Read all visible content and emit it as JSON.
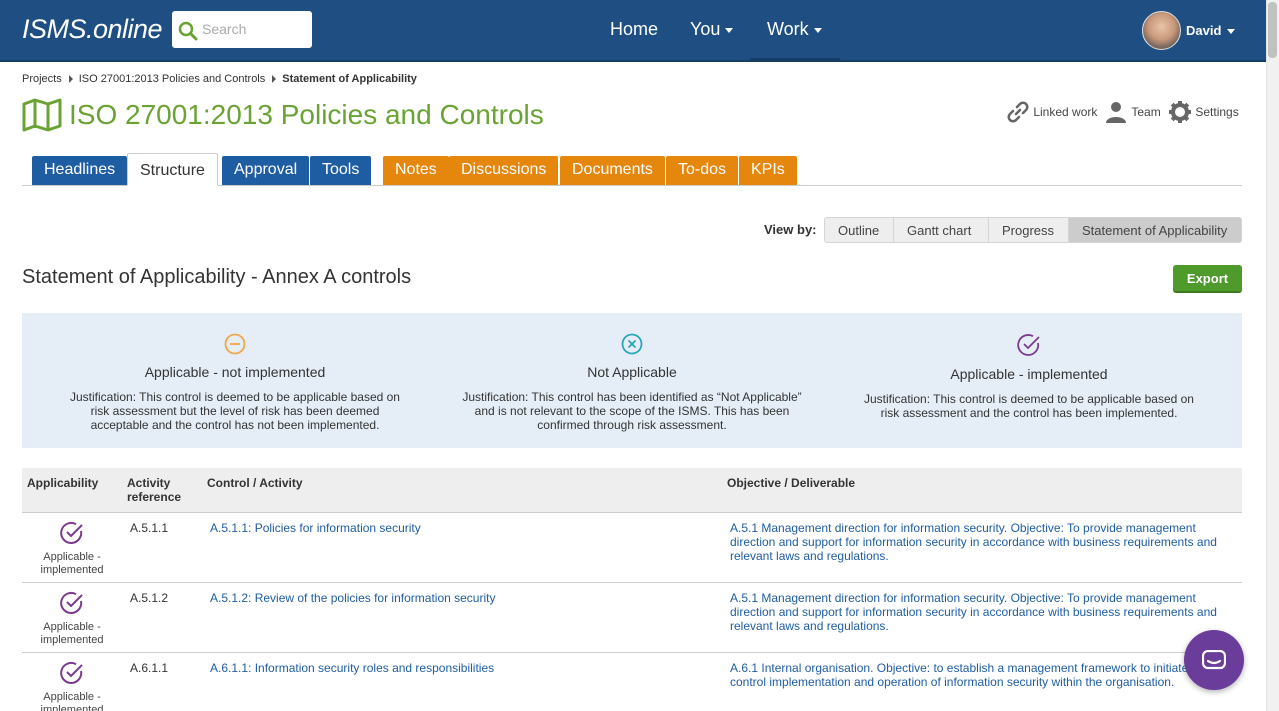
{
  "app": {
    "logo": "ISMS.online",
    "search_placeholder": "Search",
    "nav": {
      "home": "Home",
      "you": "You",
      "work": "Work"
    },
    "user": "David"
  },
  "breadcrumb": {
    "items": [
      "Projects",
      "ISO 27001:2013 Policies and Controls",
      "Statement of Applicability"
    ]
  },
  "page": {
    "title": "ISO 27001:2013 Policies and Controls",
    "links": {
      "linked_work": "Linked work",
      "team": "Team",
      "settings": "Settings"
    }
  },
  "tabs": {
    "headlines": "Headlines",
    "structure": "Structure",
    "approval": "Approval",
    "tools": "Tools",
    "notes": "Notes",
    "discussions": "Discussions",
    "documents": "Documents",
    "todos": "To-dos",
    "kpis": "KPIs"
  },
  "viewby": {
    "label": "View by:",
    "options": [
      "Outline",
      "Gantt chart",
      "Progress",
      "Statement of Applicability"
    ],
    "selected": "Statement of Applicability"
  },
  "section": {
    "title": "Statement of Applicability - Annex A controls",
    "export": "Export"
  },
  "legend": [
    {
      "title": "Applicable - not implemented",
      "text": "Justification: This control is deemed to be applicable based on risk assessment but the level of risk has been deemed acceptable and the control has not been implemented.",
      "color": "#f0a64a"
    },
    {
      "title": "Not Applicable",
      "text": "Justification: This control has been identified as “Not Applicable” and is not relevant to the scope of the ISMS. This has been confirmed through risk assessment.",
      "color": "#2aa6b8"
    },
    {
      "title": "Applicable - implemented",
      "text": "Justification: This control is deemed to be applicable based on risk assessment and the control has been implemented.",
      "color": "#7a3b8e"
    }
  ],
  "table": {
    "headers": [
      "Applicability",
      "Activity reference",
      "Control / Activity",
      "Objective / Deliverable"
    ],
    "rows": [
      {
        "applicability": "Applicable - implemented",
        "ref": "A.5.1.1",
        "control": "A.5.1.1: Policies for information security",
        "objective": "A.5.1 Management direction for information security. Objective: To provide management direction and support for information security in accordance with business requirements and relevant laws and regulations."
      },
      {
        "applicability": "Applicable - implemented",
        "ref": "A.5.1.2",
        "control": "A.5.1.2: Review of the policies for information security",
        "objective": "A.5.1 Management direction for information security. Objective: To provide management direction and support for information security in accordance with business requirements and relevant laws and regulations."
      },
      {
        "applicability": "Applicable - implemented",
        "ref": "A.6.1.1",
        "control": "A.6.1.1: Information security roles and responsibilities",
        "objective": "A.6.1 Internal organisation. Objective: to establish a management framework to initiate and control implementation and operation of information security within the organisation."
      }
    ]
  },
  "colors": {
    "nav": "#1f4f82",
    "tab_blue": "#1f5da3",
    "tab_orange": "#e5860d",
    "title_green": "#6aa334",
    "export_green": "#4e9a2a",
    "implemented_purple": "#7a3b8e",
    "chat_purple": "#6a3d9a"
  }
}
